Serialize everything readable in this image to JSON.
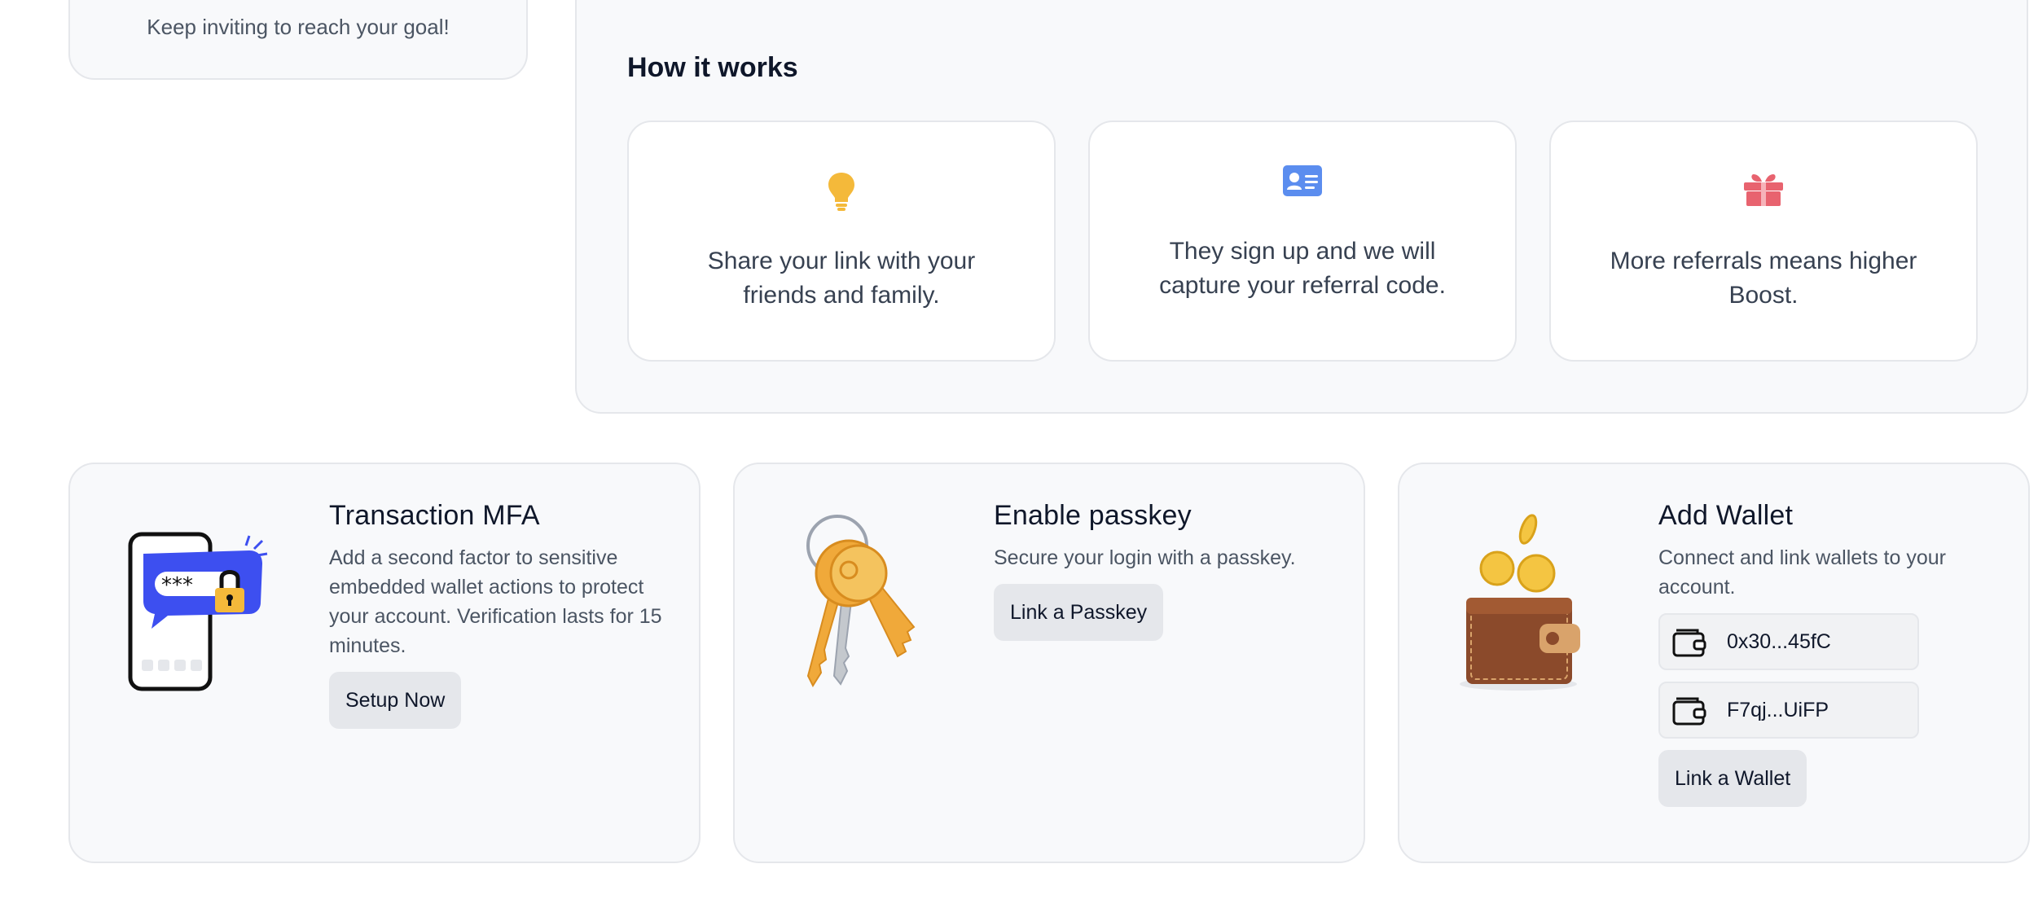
{
  "goal_card": {
    "text": "Keep inviting to reach your goal!"
  },
  "how_it_works": {
    "title": "How it works",
    "steps": [
      {
        "icon": "lightbulb-icon",
        "line1": "Share your link with your",
        "line2": "friends and family."
      },
      {
        "icon": "id-card-icon",
        "line1": "They sign up and we will",
        "line2": "capture your referral code."
      },
      {
        "icon": "gift-icon",
        "line1": "More referrals means higher",
        "line2": "Boost."
      }
    ]
  },
  "mfa": {
    "title": "Transaction MFA",
    "description": "Add a second factor to sensitive embedded wallet actions to protect your account. Verification lasts for 15 minutes.",
    "button": "Setup Now",
    "illustration": "phone-password-lock-icon"
  },
  "passkey": {
    "title": "Enable passkey",
    "description": "Secure your login with a passkey.",
    "button": "Link a Passkey",
    "illustration": "keys-icon"
  },
  "wallet": {
    "title": "Add Wallet",
    "description": "Connect and link wallets to your account.",
    "wallets": [
      "0x30...45fC",
      "F7qj...UiFP"
    ],
    "button": "Link a Wallet",
    "illustration": "wallet-coins-icon"
  },
  "colors": {
    "bulb": "#f4b93a",
    "idcard": "#5b8def",
    "gift": "#e8636f",
    "phone_bubble": "#3d4ff0",
    "card_bg": "#f8f9fb",
    "border": "#e5e7eb",
    "button_bg": "#e5e7eb"
  }
}
